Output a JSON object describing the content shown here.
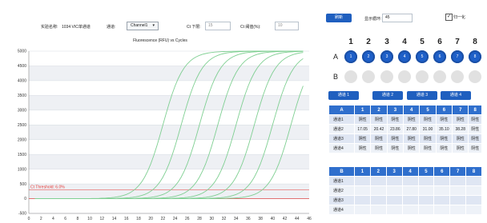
{
  "toolbar": {
    "sample_name_label": "实验名称:",
    "sample_name_value": "1034 VIC单通道",
    "channel_label": "通道:",
    "channel_value": "Channel1",
    "ct_lower_label": "Ct 下限:",
    "ct_lower_value": "15",
    "ct_threshold_label": "Ct 阈值(%):",
    "ct_threshold_value": "10",
    "refresh_label": "刷新",
    "display_cycles_label": "显示循环:",
    "display_cycles_value": "45",
    "normalize_label": "归一化",
    "normalize_checked": true
  },
  "plate": {
    "columns": [
      "1",
      "2",
      "3",
      "4",
      "5",
      "6",
      "7",
      "8"
    ],
    "rows": [
      {
        "label": "A",
        "active": true
      },
      {
        "label": "B",
        "active": false
      }
    ]
  },
  "channel_tabs": [
    "通道 1",
    "通道 2",
    "通道 3",
    "通道 4"
  ],
  "table_a": {
    "header": [
      "A",
      "1",
      "2",
      "3",
      "4",
      "5",
      "6",
      "7",
      "8"
    ],
    "rows": [
      [
        "通道1",
        "阴性",
        "阴性",
        "阴性",
        "阴性",
        "阴性",
        "阴性",
        "阴性",
        "阴性"
      ],
      [
        "通道2",
        "17.05",
        "20.42",
        "23.86",
        "27.80",
        "31.00",
        "35.10",
        "38.28",
        "阴性"
      ],
      [
        "通道3",
        "阴性",
        "阴性",
        "阴性",
        "阴性",
        "阴性",
        "阴性",
        "阴性",
        "阴性"
      ],
      [
        "通道4",
        "阴性",
        "阴性",
        "阴性",
        "阴性",
        "阴性",
        "阴性",
        "阴性",
        "阴性"
      ]
    ]
  },
  "table_b": {
    "header": [
      "B",
      "1",
      "2",
      "3",
      "4",
      "5",
      "6",
      "7",
      "8"
    ],
    "rows": [
      [
        "通道1",
        "",
        "",
        "",
        "",
        "",
        "",
        "",
        ""
      ],
      [
        "通道2",
        "",
        "",
        "",
        "",
        "",
        "",
        "",
        ""
      ],
      [
        "通道3",
        "",
        "",
        "",
        "",
        "",
        "",
        "",
        ""
      ],
      [
        "通道4",
        "",
        "",
        "",
        "",
        "",
        "",
        "",
        ""
      ]
    ]
  },
  "chart_data": {
    "type": "line",
    "title": "Fluorescence (RFU) vs Cycles",
    "xlabel": "",
    "ylabel": "",
    "xlim": [
      0,
      46
    ],
    "ylim": [
      -500,
      5000
    ],
    "xticks": [
      0,
      2,
      4,
      6,
      8,
      10,
      12,
      14,
      16,
      18,
      20,
      22,
      24,
      26,
      28,
      30,
      32,
      34,
      36,
      38,
      40,
      42,
      44,
      46
    ],
    "yticks": [
      -500,
      0,
      500,
      1000,
      1500,
      2000,
      2500,
      3000,
      3500,
      4000,
      4500,
      5000
    ],
    "threshold": {
      "value": 300,
      "label": "Ct Threshold: 6.0%",
      "color": "#e53935"
    },
    "curve_color": "#7fcf92",
    "baseline_color": "#e06060",
    "series_midpoints": [
      22,
      25,
      28,
      31,
      34,
      37,
      40,
      43
    ]
  },
  "colors": {
    "accent": "#1f5fbf",
    "header_blue": "#2f6fcd",
    "well_on": "#1e5fc8",
    "well_off": "#e1e1e1"
  }
}
